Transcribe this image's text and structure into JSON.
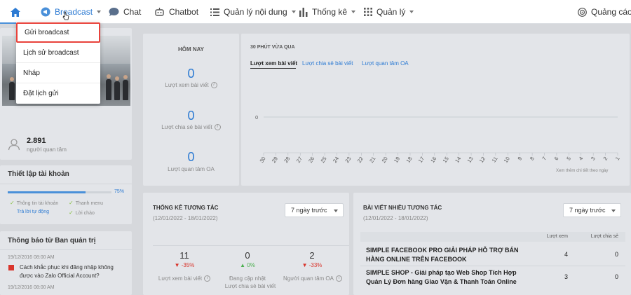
{
  "nav": {
    "broadcast": "Broadcast",
    "chat": "Chat",
    "chatbot": "Chatbot",
    "content": "Quản lý nội dung",
    "stats": "Thống kê",
    "manage": "Quản lý",
    "ads": "Quảng cáo"
  },
  "dropdown": {
    "items": [
      "Gửi broadcast",
      "Lịch sử broadcast",
      "Nháp",
      "Đặt lịch gửi"
    ]
  },
  "profile": {
    "followers": "2.891",
    "followers_label": "người quan tâm"
  },
  "account": {
    "title": "Thiết lập tài khoản",
    "progress": "75%",
    "progress_value": 0.75,
    "tasks": [
      "Thông tin tài khoản",
      "Thanh menu",
      "Trả lời tự động",
      "Lời chào"
    ]
  },
  "notice": {
    "title": "Thông báo từ Ban quản trị",
    "date": "19/12/2016 08:00 AM",
    "text": "Cách khắc phục khi đăng nhập không được vào Zalo Official Account?",
    "date2": "19/12/2016 08:00 AM"
  },
  "today": {
    "title": "HÔM NAY",
    "metrics": [
      {
        "value": "0",
        "label": "Lượt xem bài viết"
      },
      {
        "value": "0",
        "label": "Lượt chia sẻ bài viết"
      },
      {
        "value": "0",
        "label": "Lượt quan tâm OA"
      }
    ]
  },
  "chart": {
    "title": "30 PHÚT VỪA QUA",
    "tabs": [
      "Lượt xem bài viết",
      "Lượt chia sẻ bài viết",
      "Lượt quan tâm OA"
    ],
    "more": "Xem thêm chi tiết theo ngày"
  },
  "chart_data": {
    "type": "line",
    "x": [
      "30",
      "29",
      "28",
      "27",
      "26",
      "25",
      "24",
      "23",
      "22",
      "21",
      "20",
      "19",
      "18",
      "17",
      "16",
      "15",
      "14",
      "13",
      "12",
      "11",
      "10",
      "9",
      "8",
      "7",
      "6",
      "5",
      "4",
      "3",
      "2",
      "1"
    ],
    "series": [
      {
        "values": [
          0,
          0,
          0,
          0,
          0,
          0,
          0,
          0,
          0,
          0,
          0,
          0,
          0,
          0,
          0,
          0,
          0,
          0,
          0,
          0,
          0,
          0,
          0,
          0,
          0,
          0,
          0,
          0,
          0,
          0
        ]
      }
    ],
    "y_ticks": [
      "0"
    ],
    "grid": true
  },
  "interaction": {
    "title": "THỐNG KÊ TƯƠNG TÁC",
    "range": "(12/01/2022 - 18/01/2022)",
    "select": "7 ngày trước",
    "metrics": [
      {
        "value": "11",
        "change": "-35%",
        "direction": "down",
        "label": "Lượt xem bài viết"
      },
      {
        "value": "0",
        "change": "0%",
        "direction": "up",
        "label": "Đang cập nhật",
        "label2": "Lượt chia sẻ bài viết"
      },
      {
        "value": "2",
        "change": "-33%",
        "direction": "down",
        "label": "Người quan tâm OA"
      }
    ]
  },
  "posts": {
    "title": "BÀI VIẾT NHIỀU TƯƠNG TÁC",
    "range": "(12/01/2022 - 18/01/2022)",
    "select": "7 ngày trước",
    "col_views": "Lượt xem",
    "col_shares": "Lượt chia sẻ",
    "rows": [
      {
        "title1": "SIMPLE FACEBOOK PRO GIẢI PHÁP HỖ TRỢ BÁN",
        "title2": "HÀNG ONLINE TRÊN FACEBOOK",
        "views": "4",
        "shares": "0"
      },
      {
        "title1": "SIMPLE SHOP - Giải pháp tạo Web Shop Tích Hợp",
        "title2": "Quản Lý Đơn hàng Giao Vận & Thanh Toán Online",
        "views": "3",
        "shares": "0"
      }
    ]
  },
  "colors": {
    "accent": "#2d7bd3",
    "danger": "#e8423b",
    "positive": "#4caf50"
  }
}
